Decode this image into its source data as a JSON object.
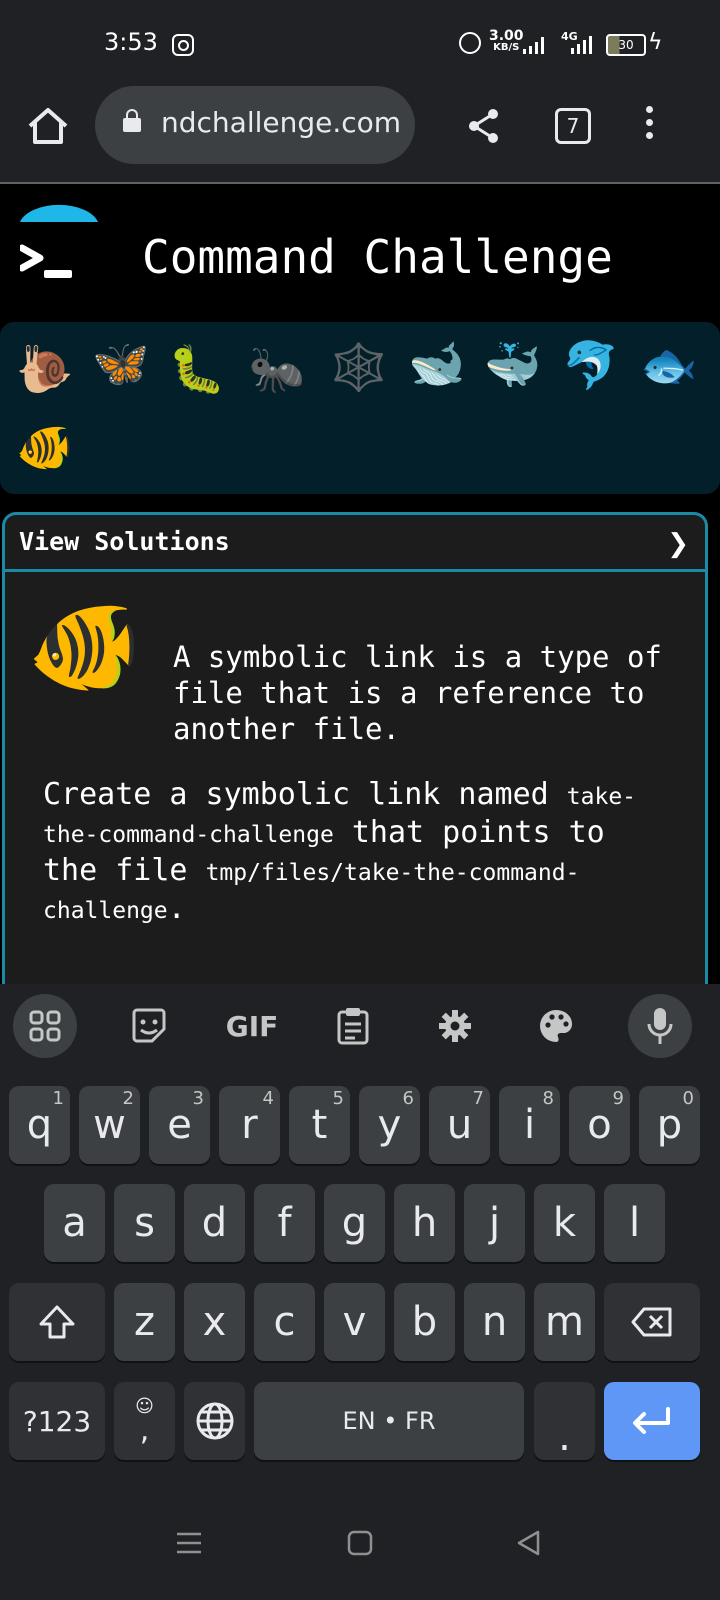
{
  "status": {
    "time": "3:53",
    "speed_value": "3.00",
    "speed_unit": "KB/S",
    "network": "4G",
    "battery": "30"
  },
  "browser": {
    "url": "ndchallenge.com",
    "tab_count": "7"
  },
  "site": {
    "title": "Command Challenge"
  },
  "animals": [
    "🐌",
    "🦋",
    "🐛",
    "🐜",
    "🕸️",
    "🐋",
    "🐳",
    "🐬",
    "🐟",
    "🐠"
  ],
  "panel": {
    "header": "View Solutions",
    "chevron": "❯",
    "fish": "🐠",
    "intro": "A symbolic link is a type of file that is a reference to another file.",
    "task_pre": "Create a symbolic link named ",
    "task_code1": "take-the-command-challenge",
    "task_mid": " that points to the file ",
    "task_code2": "tmp/files/take-the-command-challenge",
    "task_post": "."
  },
  "keyboard": {
    "toolbar": {
      "gif": "GIF"
    },
    "row1": [
      "q",
      "w",
      "e",
      "r",
      "t",
      "y",
      "u",
      "i",
      "o",
      "p"
    ],
    "row1_hints": [
      "1",
      "2",
      "3",
      "4",
      "5",
      "6",
      "7",
      "8",
      "9",
      "0"
    ],
    "row2": [
      "a",
      "s",
      "d",
      "f",
      "g",
      "h",
      "j",
      "k",
      "l"
    ],
    "row3": [
      "z",
      "x",
      "c",
      "v",
      "b",
      "n",
      "m"
    ],
    "symbols": "?123",
    "comma": ",",
    "space": "EN • FR",
    "period": "."
  }
}
